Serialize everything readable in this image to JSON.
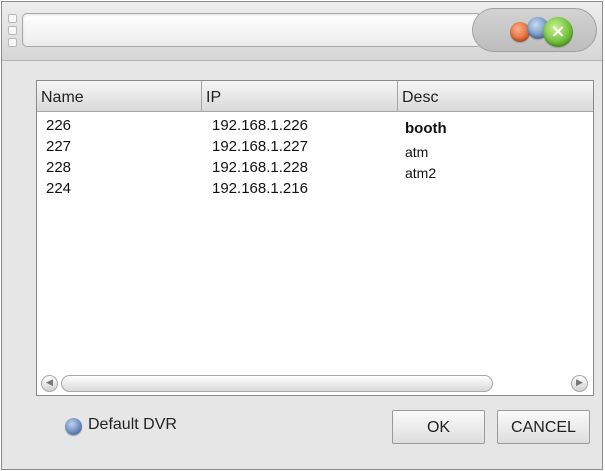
{
  "window": {
    "title": ""
  },
  "table": {
    "columns": [
      "Name",
      "IP",
      "Desc"
    ],
    "rows": [
      {
        "name": "226",
        "ip": "192.168.1.226",
        "desc": "booth"
      },
      {
        "name": "227",
        "ip": "192.168.1.227",
        "desc": "atm"
      },
      {
        "name": "228",
        "ip": "192.168.1.228",
        "desc": "atm2"
      },
      {
        "name": "224",
        "ip": "192.168.1.216",
        "desc": ""
      }
    ]
  },
  "footer": {
    "default_dvr_label": "Default DVR",
    "ok_label": "OK",
    "cancel_label": "CANCEL"
  },
  "icons": {
    "close": "close-icon",
    "minimize": "minimize-icon",
    "maximize": "maximize-icon",
    "scroll_left": "scroll-left-icon",
    "scroll_right": "scroll-right-icon"
  },
  "colors": {
    "close_button": "#5cb42a",
    "minimize_button": "#e0602a",
    "maximize_button": "#5f86b6",
    "radio": "#4d72a6"
  }
}
